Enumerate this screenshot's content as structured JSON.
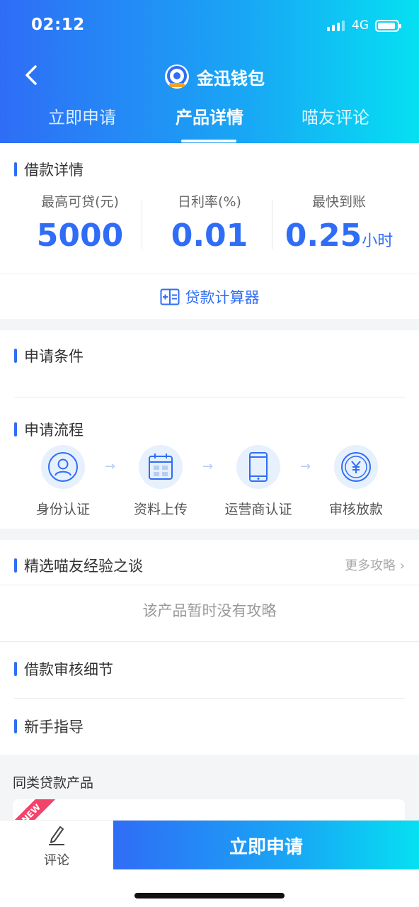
{
  "status": {
    "time": "02:12",
    "network": "4G"
  },
  "header": {
    "title": "金迅钱包",
    "logo_icon": "wallet-logo-icon"
  },
  "tabs": [
    {
      "label": "立即申请",
      "active": false
    },
    {
      "label": "产品详情",
      "active": true
    },
    {
      "label": "喵友评论",
      "active": false
    }
  ],
  "loan": {
    "title": "借款详情",
    "stats": [
      {
        "label": "最高可贷(元)",
        "value": "5000",
        "unit": ""
      },
      {
        "label": "日利率(%)",
        "value": "0.01",
        "unit": ""
      },
      {
        "label": "最快到账",
        "value": "0.25",
        "unit": "小时"
      }
    ],
    "calculator_label": "贷款计算器"
  },
  "conditions": {
    "title": "申请条件"
  },
  "process": {
    "title": "申请流程",
    "steps": [
      {
        "label": "身份认证",
        "icon": "id-user-icon"
      },
      {
        "label": "资料上传",
        "icon": "calendar-icon"
      },
      {
        "label": "运营商认证",
        "icon": "phone-icon"
      },
      {
        "label": "审核放款",
        "icon": "yen-coin-icon"
      }
    ]
  },
  "experience": {
    "title": "精选喵友经验之谈",
    "more_label": "更多攻略",
    "empty_text": "该产品暂时没有攻略"
  },
  "review_detail": {
    "title": "借款审核细节"
  },
  "guide": {
    "title": "新手指导"
  },
  "similar": {
    "title": "同类贷款产品",
    "badge": "NEW"
  },
  "bottom": {
    "comment_label": "评论",
    "apply_label": "立即申请"
  },
  "colors": {
    "accent": "#2f6df6",
    "gradient_end": "#05e0f2"
  }
}
